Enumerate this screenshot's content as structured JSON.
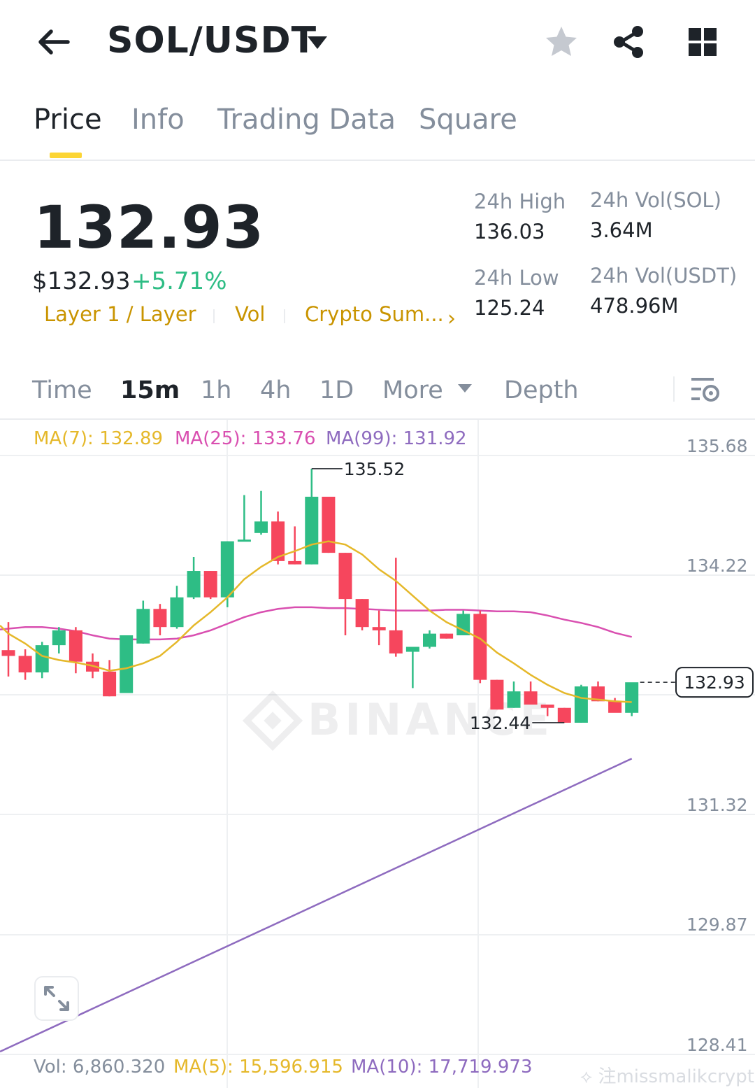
{
  "header": {
    "pair": "SOL/USDT"
  },
  "tabs": [
    {
      "label": "Price",
      "active": true
    },
    {
      "label": "Info",
      "active": false
    },
    {
      "label": "Trading Data",
      "active": false
    },
    {
      "label": "Square",
      "active": false
    }
  ],
  "price": {
    "last": "132.93",
    "usd": "$132.93",
    "change": "+5.71%",
    "tags": [
      "Layer 1 / Layer",
      "Vol",
      "Crypto Sum..."
    ],
    "tags_arrow": "›"
  },
  "stats": {
    "high_label": "24h High",
    "high_value": "136.03",
    "low_label": "24h Low",
    "low_value": "125.24",
    "vol_base_label": "24h Vol(SOL)",
    "vol_base_value": "3.64M",
    "vol_quote_label": "24h Vol(USDT)",
    "vol_quote_value": "478.96M"
  },
  "intervals": {
    "time": "Time",
    "m15": "15m",
    "h1": "1h",
    "h4": "4h",
    "d1": "1D",
    "more": "More",
    "depth": "Depth",
    "selected": "15m"
  },
  "colors": {
    "up": "#2ebd85",
    "down": "#f6465d",
    "ma7": "#e5b82a",
    "ma25": "#d94fb0",
    "ma99": "#8e6bbf",
    "brand": "#fcd535"
  },
  "chart_data": {
    "type": "candlestick",
    "interval": "15m",
    "ma_legend": {
      "ma7": "MA(7): 132.89",
      "ma25": "MA(25): 133.76",
      "ma99": "MA(99): 131.92"
    },
    "y_ticks": [
      "135.68",
      "134.22",
      "131.32",
      "129.87",
      "128.41"
    ],
    "current_price_label": "132.93",
    "high_marker": "135.52",
    "low_marker": "132.44",
    "watermark": "BINANCE",
    "candles": [
      {
        "o": 133.32,
        "h": 133.66,
        "l": 133.0,
        "c": 133.25
      },
      {
        "o": 133.25,
        "h": 133.33,
        "l": 132.96,
        "c": 133.05
      },
      {
        "o": 133.05,
        "h": 133.42,
        "l": 132.98,
        "c": 133.38
      },
      {
        "o": 133.38,
        "h": 133.6,
        "l": 133.28,
        "c": 133.56
      },
      {
        "o": 133.56,
        "h": 133.6,
        "l": 133.04,
        "c": 133.18
      },
      {
        "o": 133.18,
        "h": 133.28,
        "l": 132.98,
        "c": 133.06
      },
      {
        "o": 133.06,
        "h": 133.2,
        "l": 132.76,
        "c": 132.76
      },
      {
        "o": 132.8,
        "h": 133.5,
        "l": 132.8,
        "c": 133.5
      },
      {
        "o": 133.4,
        "h": 133.92,
        "l": 133.4,
        "c": 133.82
      },
      {
        "o": 133.82,
        "h": 133.88,
        "l": 133.5,
        "c": 133.6
      },
      {
        "o": 133.6,
        "h": 134.1,
        "l": 133.58,
        "c": 133.96
      },
      {
        "o": 133.96,
        "h": 134.45,
        "l": 133.94,
        "c": 134.28
      },
      {
        "o": 134.28,
        "h": 134.28,
        "l": 133.94,
        "c": 133.96
      },
      {
        "o": 133.96,
        "h": 134.64,
        "l": 133.84,
        "c": 134.64
      },
      {
        "o": 134.64,
        "h": 135.2,
        "l": 134.64,
        "c": 134.66
      },
      {
        "o": 134.74,
        "h": 135.25,
        "l": 134.72,
        "c": 134.88
      },
      {
        "o": 134.88,
        "h": 135.0,
        "l": 134.36,
        "c": 134.4
      },
      {
        "o": 134.4,
        "h": 134.82,
        "l": 134.36,
        "c": 134.36
      },
      {
        "o": 134.36,
        "h": 135.52,
        "l": 134.36,
        "c": 135.18
      },
      {
        "o": 135.18,
        "h": 135.18,
        "l": 134.5,
        "c": 134.5
      },
      {
        "o": 134.5,
        "h": 134.5,
        "l": 133.5,
        "c": 133.94
      },
      {
        "o": 133.94,
        "h": 133.94,
        "l": 133.56,
        "c": 133.6
      },
      {
        "o": 133.6,
        "h": 133.8,
        "l": 133.38,
        "c": 133.56
      },
      {
        "o": 133.56,
        "h": 134.44,
        "l": 133.24,
        "c": 133.28
      },
      {
        "o": 133.3,
        "h": 133.36,
        "l": 132.86,
        "c": 133.36
      },
      {
        "o": 133.36,
        "h": 133.56,
        "l": 133.34,
        "c": 133.52
      },
      {
        "o": 133.52,
        "h": 133.52,
        "l": 133.46,
        "c": 133.46
      },
      {
        "o": 133.5,
        "h": 133.8,
        "l": 133.5,
        "c": 133.76
      },
      {
        "o": 133.76,
        "h": 133.8,
        "l": 132.92,
        "c": 132.96
      },
      {
        "o": 132.96,
        "h": 132.96,
        "l": 132.6,
        "c": 132.6
      },
      {
        "o": 132.62,
        "h": 132.94,
        "l": 132.62,
        "c": 132.82
      },
      {
        "o": 132.82,
        "h": 132.94,
        "l": 132.7,
        "c": 132.66
      },
      {
        "o": 132.66,
        "h": 132.66,
        "l": 132.52,
        "c": 132.62
      },
      {
        "o": 132.62,
        "h": 132.62,
        "l": 132.44,
        "c": 132.44
      },
      {
        "o": 132.44,
        "h": 132.9,
        "l": 132.44,
        "c": 132.88
      },
      {
        "o": 132.88,
        "h": 132.94,
        "l": 132.7,
        "c": 132.7
      },
      {
        "o": 132.7,
        "h": 132.74,
        "l": 132.6,
        "c": 132.56
      },
      {
        "o": 132.56,
        "h": 132.66,
        "l": 132.52,
        "c": 132.93
      }
    ],
    "ma7": [
      133.52,
      133.4,
      133.25,
      133.2,
      133.17,
      133.13,
      133.07,
      133.1,
      133.16,
      133.25,
      133.42,
      133.62,
      133.78,
      133.96,
      134.18,
      134.33,
      134.45,
      134.52,
      134.6,
      134.64,
      134.6,
      134.48,
      134.3,
      134.16,
      133.98,
      133.8,
      133.66,
      133.56,
      133.46,
      133.29,
      133.16,
      133.02,
      132.9,
      132.8,
      132.74,
      132.72,
      132.7,
      132.69
    ],
    "ma25": [
      133.58,
      133.6,
      133.6,
      133.58,
      133.55,
      133.5,
      133.46,
      133.45,
      133.45,
      133.45,
      133.46,
      133.5,
      133.56,
      133.64,
      133.72,
      133.78,
      133.82,
      133.84,
      133.84,
      133.83,
      133.83,
      133.82,
      133.81,
      133.8,
      133.8,
      133.8,
      133.81,
      133.81,
      133.8,
      133.79,
      133.79,
      133.78,
      133.74,
      133.69,
      133.65,
      133.6,
      133.53,
      133.48
    ],
    "ma99_line": {
      "start": 128.41,
      "end": 131.92
    }
  },
  "volume": {
    "vol": "Vol: 6,860.320",
    "ma5": "MA(5): 15,596.915",
    "ma10": "MA(10): 17,719.973"
  },
  "watermark_user": "⟡ 注missmalikcrypto"
}
